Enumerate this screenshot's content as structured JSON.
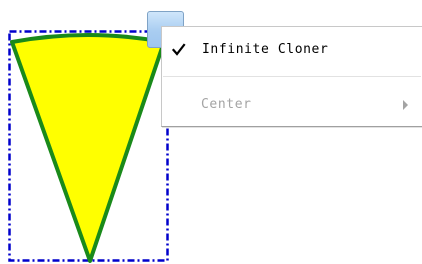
{
  "context_menu": {
    "items": [
      {
        "label": "Infinite Cloner",
        "checked": true,
        "enabled": true,
        "icon": "check-icon"
      },
      {
        "label": "Center",
        "checked": false,
        "enabled": false,
        "has_submenu": true,
        "icon": "submenu-arrow-icon"
      }
    ]
  },
  "canvas": {
    "shape": "wedge",
    "colors": {
      "shape_fill": "#ffff00",
      "shape_stroke": "#1a8a1a",
      "selection_border": "#0000cc",
      "handle_fill": "#a9cdf1",
      "menu_text": "#000000",
      "menu_disabled_text": "#a4a4a4"
    }
  }
}
